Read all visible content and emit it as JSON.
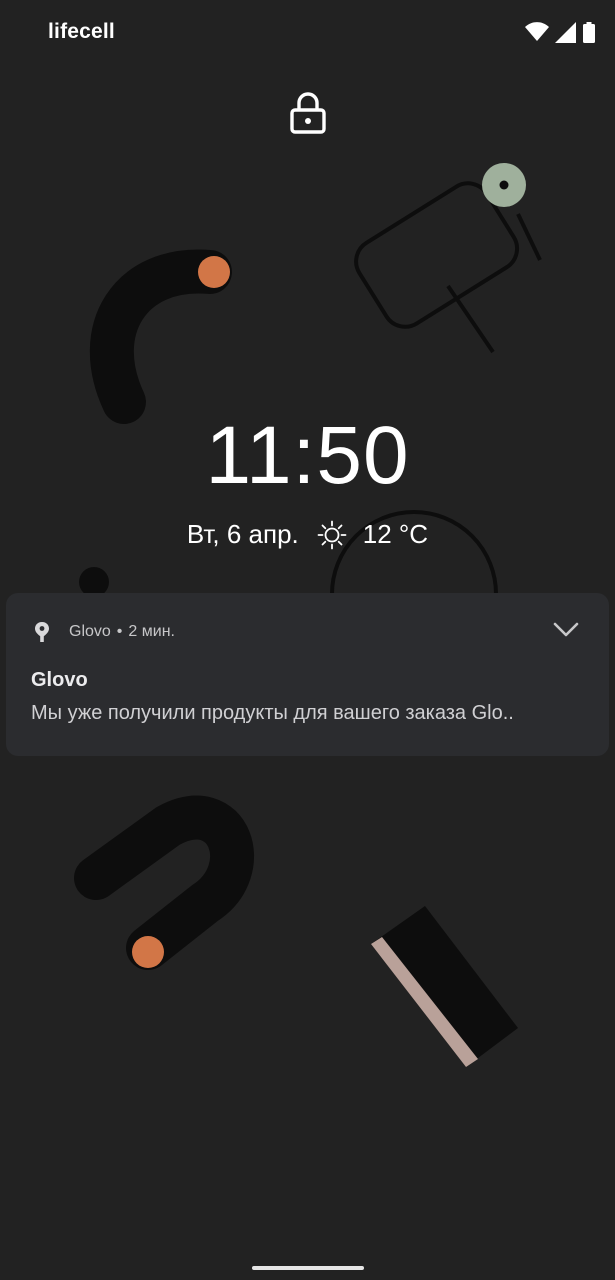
{
  "status_bar": {
    "carrier": "lifecell",
    "icons": [
      "wifi-icon",
      "cellular-signal-icon",
      "battery-icon"
    ]
  },
  "lockscreen": {
    "lock_icon": "lock-icon",
    "time": "11:50",
    "date": "Вт, 6 апр.",
    "weather_icon": "sun-icon",
    "temperature": "12 °C"
  },
  "notification": {
    "app_icon": "location-pin-icon",
    "app_name": "Glovo",
    "separator": "•",
    "time_ago": "2 мин.",
    "title": "Glovo",
    "text": "Мы уже получили продукты для вашего заказа Glo..",
    "expand_icon": "chevron-down-icon"
  },
  "colors": {
    "background": "#222222",
    "notification_bg": "#2b2c2f",
    "accent_orange": "#d27647",
    "accent_sage": "#9fb09c",
    "accent_beige": "#b9a199",
    "shape_black": "#0d0d0d"
  }
}
